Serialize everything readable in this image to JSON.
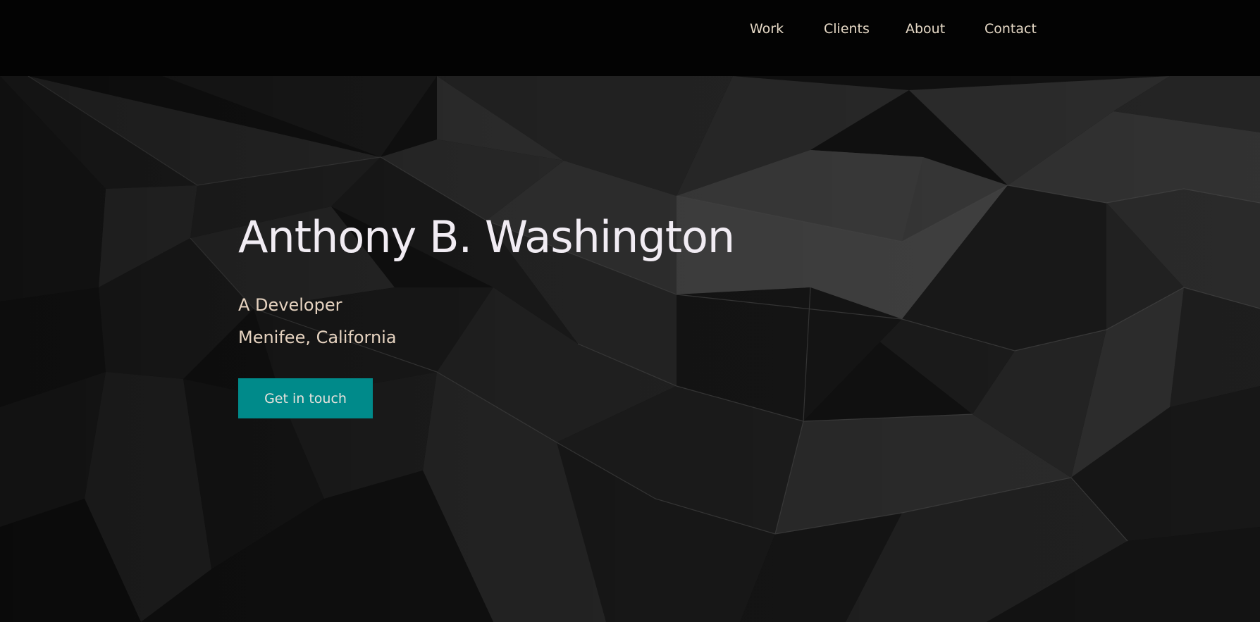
{
  "nav": {
    "items": [
      {
        "label": "Work"
      },
      {
        "label": "Clients"
      },
      {
        "label": "About"
      },
      {
        "label": "Contact"
      }
    ]
  },
  "hero": {
    "name": "Anthony B. Washington",
    "role": "A Developer",
    "location": "Menifee, California",
    "cta_label": "Get in touch",
    "background": "dark faceted polygon pattern"
  },
  "colors": {
    "accent": "#008a8a",
    "nav_text": "#e6d9c6",
    "title_text": "#f1ecf3",
    "subtitle_text": "#e6d3c0",
    "background": "#000000"
  }
}
